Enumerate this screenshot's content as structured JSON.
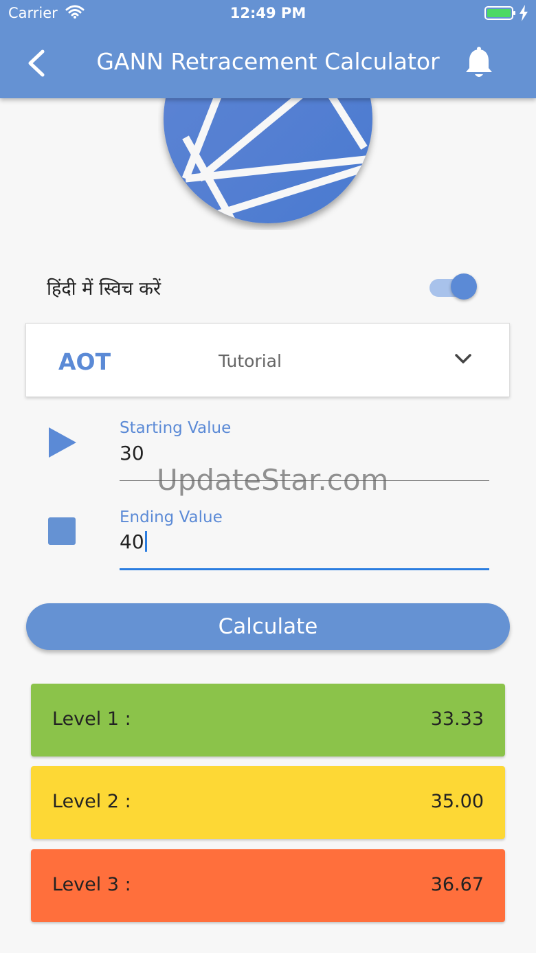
{
  "status_bar": {
    "carrier": "Carrier",
    "time": "12:49 PM"
  },
  "app_bar": {
    "title": "GANN Retracement Calculator"
  },
  "language_toggle": {
    "label": "हिंदी में स्विच करें",
    "on": true
  },
  "dropdown": {
    "code": "AOT",
    "selected": "Tutorial"
  },
  "start_field": {
    "label": "Starting Value",
    "value": "30"
  },
  "end_field": {
    "label": "Ending Value",
    "value": "40"
  },
  "watermark": "UpdateStar.com",
  "calculate_label": "Calculate",
  "levels": [
    {
      "name": "Level 1 :",
      "value": "33.33",
      "color": "#8bc34a"
    },
    {
      "name": "Level 2 :",
      "value": "35.00",
      "color": "#fdd835"
    },
    {
      "name": "Level 3 :",
      "value": "36.67",
      "color": "#ff6f3c"
    }
  ],
  "colors": {
    "primary": "#6592d3",
    "accent": "#5b8ad6",
    "background": "#f7f7f7"
  },
  "icons": [
    "back-arrow-icon",
    "bell-icon",
    "chevron-down-icon",
    "play-icon",
    "stop-icon",
    "wifi-icon",
    "battery-icon"
  ]
}
